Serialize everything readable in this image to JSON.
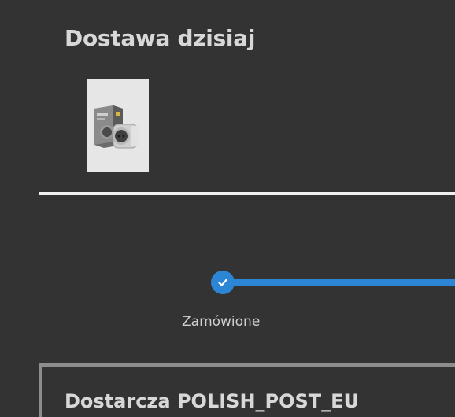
{
  "delivery": {
    "title": "Dostawa dzisiaj",
    "product_image": "smart-plug-product-image"
  },
  "tracking": {
    "steps": [
      {
        "label": "Zamówione",
        "completed": true
      }
    ],
    "accent_color": "#2d86d5"
  },
  "carrier": {
    "text": "Dostarcza POLISH_POST_EU"
  },
  "colors": {
    "background": "#333333",
    "text": "#d8d8d8",
    "divider": "#f0f0f0",
    "box_border": "#8d8d8d"
  }
}
